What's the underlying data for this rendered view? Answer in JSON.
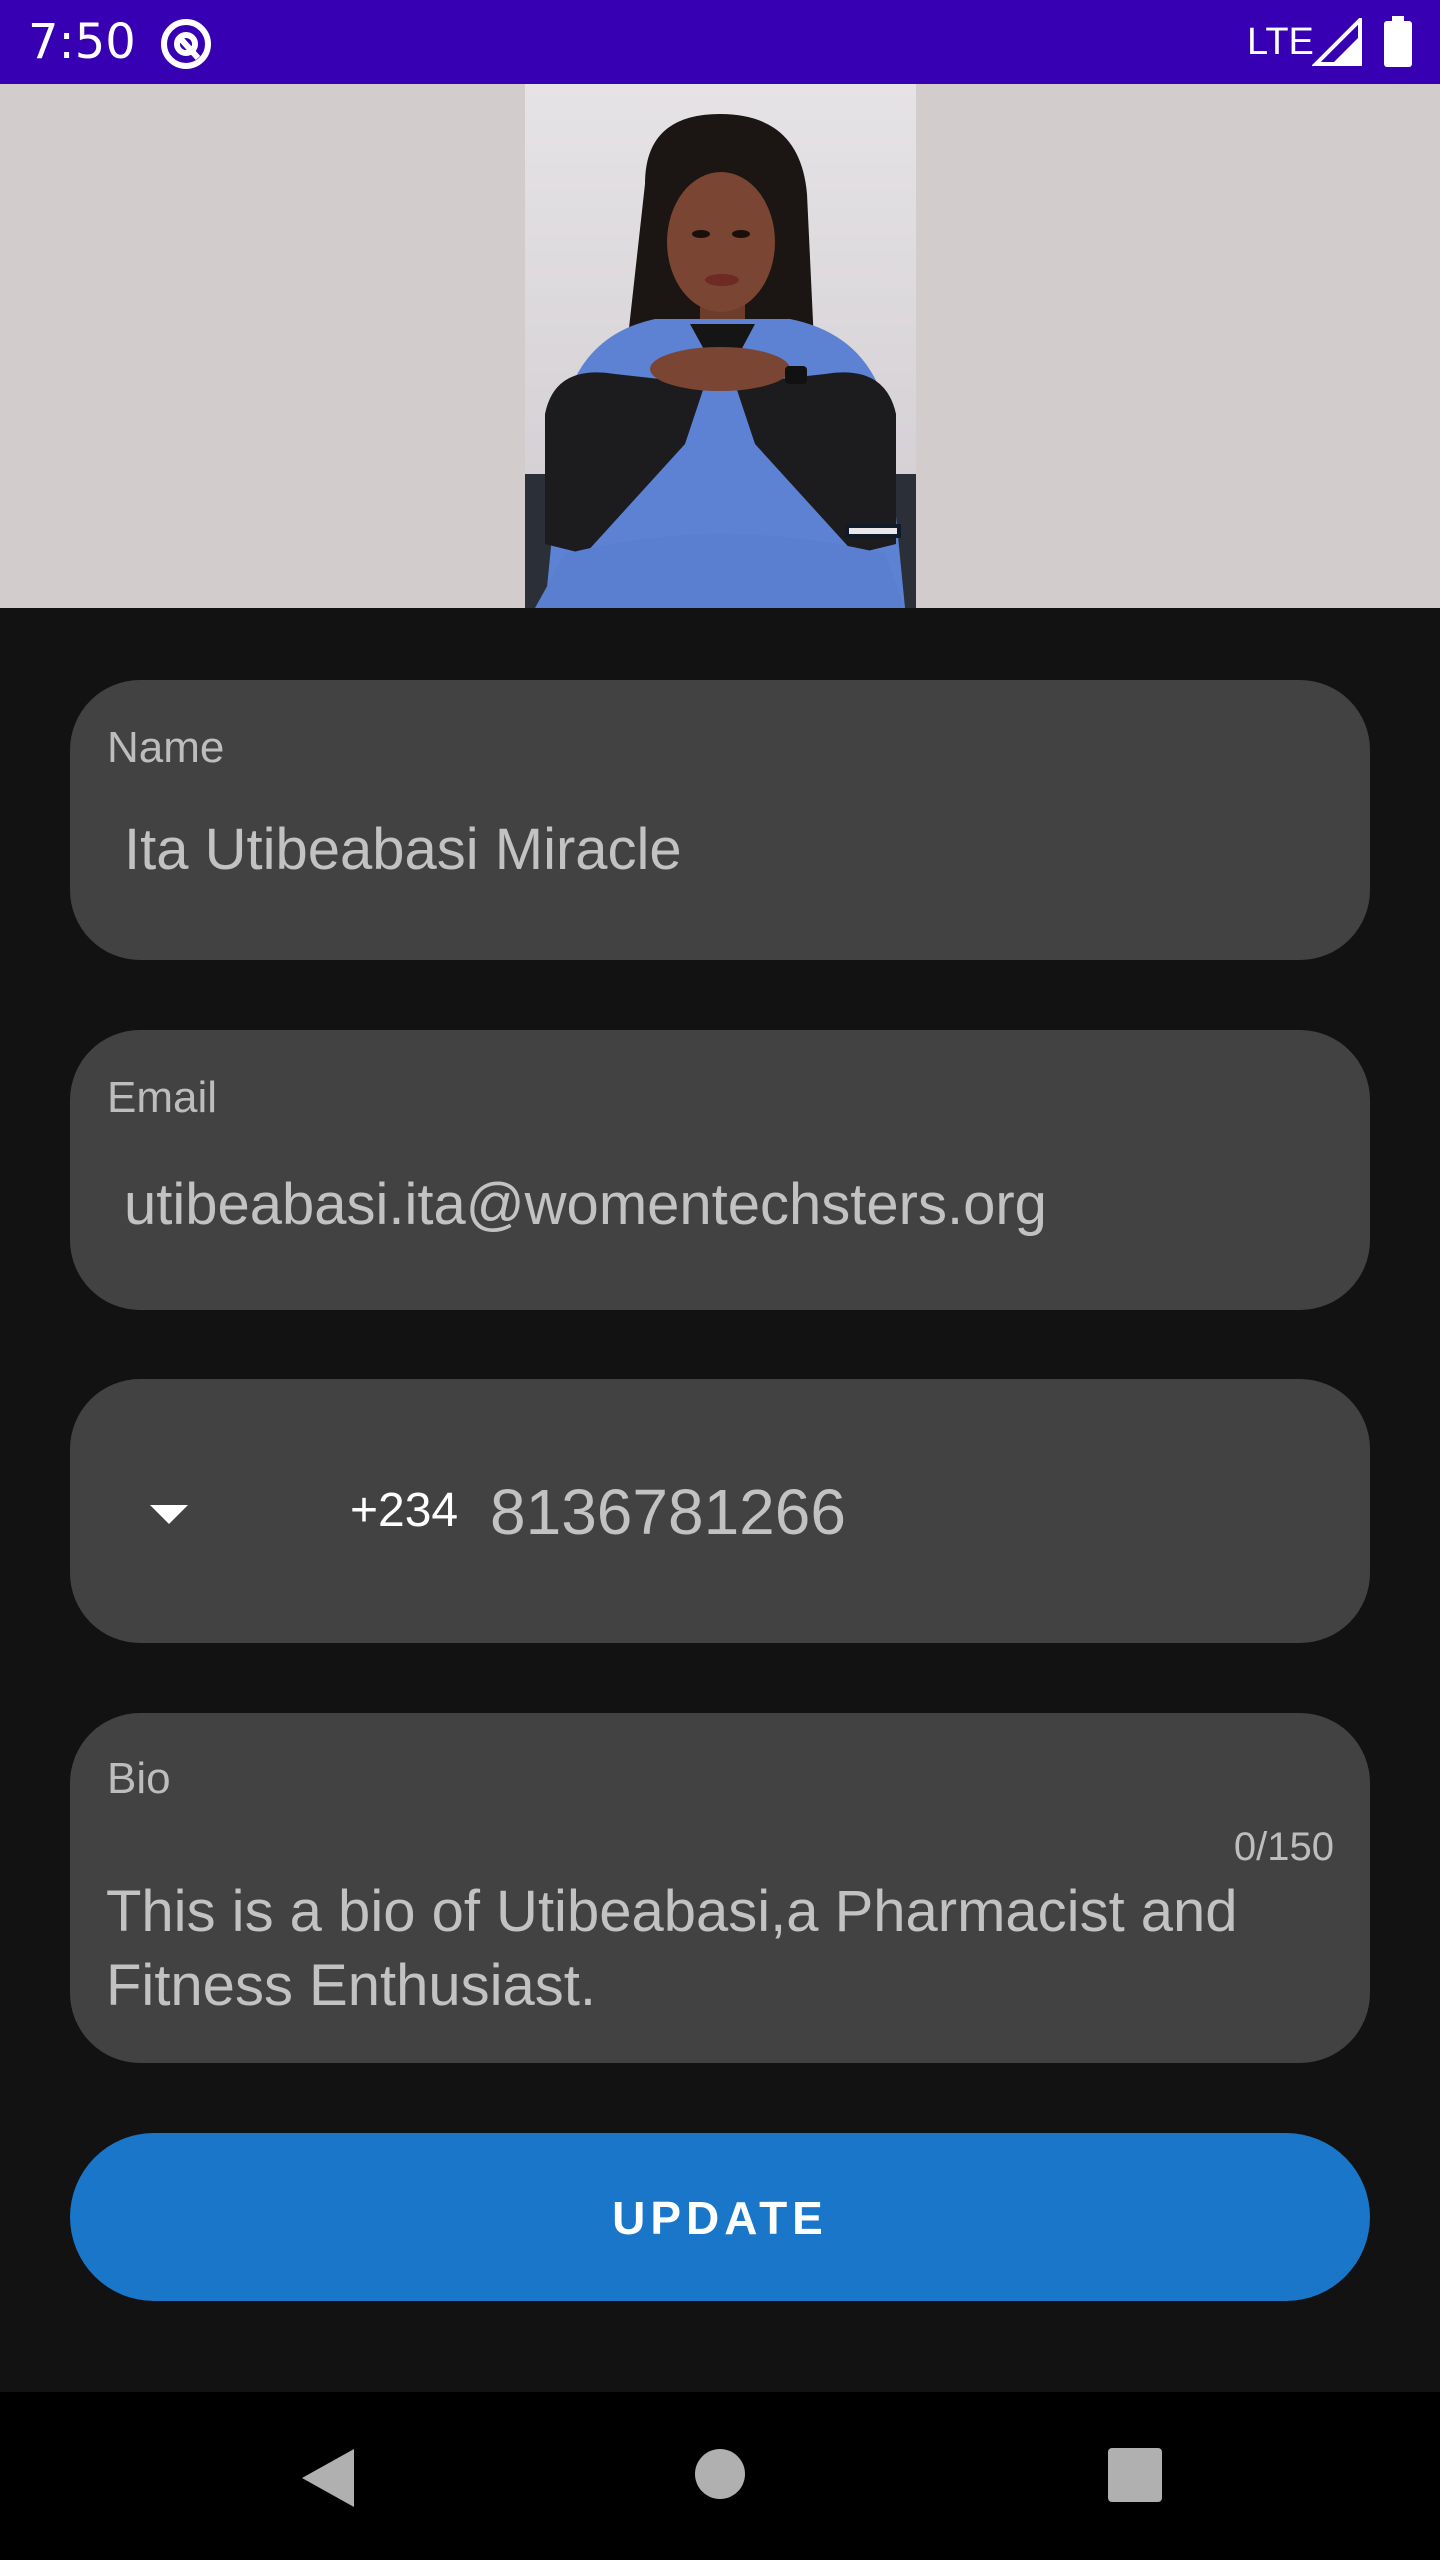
{
  "status_bar": {
    "time": "7:50",
    "network": "LTE",
    "icons": [
      "app-notification-icon",
      "signal-icon",
      "battery-icon"
    ],
    "color": "#3700b3"
  },
  "profile": {
    "photo_description_icon": "profile-photo"
  },
  "form": {
    "name": {
      "label": "Name",
      "value": "Ita Utibeabasi Miracle"
    },
    "email": {
      "label": "Email",
      "value": "utibeabasi.ita@womentechsters.org"
    },
    "phone": {
      "country_code": "+234",
      "number": "8136781266"
    },
    "bio": {
      "label": "Bio",
      "counter": "0/150",
      "value": "This is a bio of Utibeabasi,a Pharmacist and Fitness Enthusiast."
    },
    "update_button_label": "UPDATE"
  },
  "colors": {
    "background": "#121212",
    "field": "#424242",
    "accent": "#1976c8"
  },
  "nav_bar": {
    "icons": [
      "back-icon",
      "home-icon",
      "recents-icon"
    ]
  }
}
